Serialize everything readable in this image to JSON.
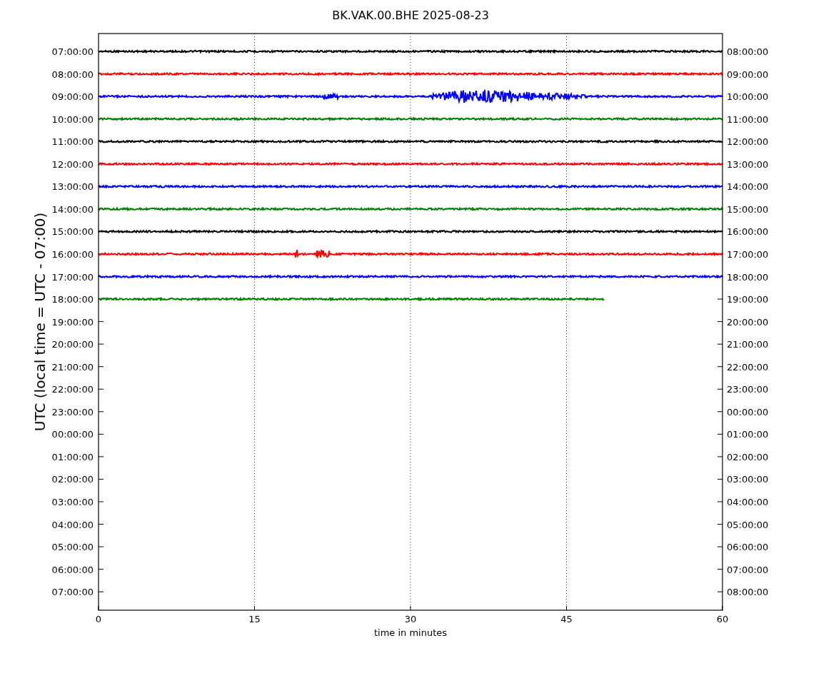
{
  "title": "BK.VAK.00.BHE 2025-08-23",
  "ylabel": "UTC (local time = UTC - 07:00)",
  "xlabel": "time in minutes",
  "xticks": [
    "0",
    "15",
    "30",
    "45",
    "60"
  ],
  "rows": [
    {
      "left": "07:00:00",
      "right": "08:00:00"
    },
    {
      "left": "08:00:00",
      "right": "09:00:00"
    },
    {
      "left": "09:00:00",
      "right": "10:00:00"
    },
    {
      "left": "10:00:00",
      "right": "11:00:00"
    },
    {
      "left": "11:00:00",
      "right": "12:00:00"
    },
    {
      "left": "12:00:00",
      "right": "13:00:00"
    },
    {
      "left": "13:00:00",
      "right": "14:00:00"
    },
    {
      "left": "14:00:00",
      "right": "15:00:00"
    },
    {
      "left": "15:00:00",
      "right": "16:00:00"
    },
    {
      "left": "16:00:00",
      "right": "17:00:00"
    },
    {
      "left": "17:00:00",
      "right": "18:00:00"
    },
    {
      "left": "18:00:00",
      "right": "19:00:00"
    },
    {
      "left": "19:00:00",
      "right": "20:00:00"
    },
    {
      "left": "20:00:00",
      "right": "21:00:00"
    },
    {
      "left": "21:00:00",
      "right": "22:00:00"
    },
    {
      "left": "22:00:00",
      "right": "23:00:00"
    },
    {
      "left": "23:00:00",
      "right": "00:00:00"
    },
    {
      "left": "00:00:00",
      "right": "01:00:00"
    },
    {
      "left": "01:00:00",
      "right": "02:00:00"
    },
    {
      "left": "02:00:00",
      "right": "03:00:00"
    },
    {
      "left": "03:00:00",
      "right": "04:00:00"
    },
    {
      "left": "04:00:00",
      "right": "05:00:00"
    },
    {
      "left": "05:00:00",
      "right": "06:00:00"
    },
    {
      "left": "06:00:00",
      "right": "07:00:00"
    },
    {
      "left": "07:00:00",
      "right": "08:00:00"
    }
  ],
  "traces": [
    {
      "color": "#000000",
      "kind": "quiet",
      "level": 1
    },
    {
      "color": "#ff0000",
      "kind": "quiet",
      "level": 1
    },
    {
      "color": "#0000ff",
      "kind": "quake",
      "level": 1
    },
    {
      "color": "#008000",
      "kind": "quiet",
      "level": 1
    },
    {
      "color": "#000000",
      "kind": "quiet",
      "level": 1
    },
    {
      "color": "#ff0000",
      "kind": "quiet",
      "level": 1
    },
    {
      "color": "#0000ff",
      "kind": "quiet",
      "level": 1
    },
    {
      "color": "#008000",
      "kind": "quiet",
      "level": 1
    },
    {
      "color": "#000000",
      "kind": "quiet",
      "level": 1
    },
    {
      "color": "#ff0000",
      "kind": "spike",
      "level": 1
    },
    {
      "color": "#0000ff",
      "kind": "quiet",
      "level": 1
    },
    {
      "color": "#008000",
      "kind": "quiet",
      "level": 0.81
    }
  ]
}
